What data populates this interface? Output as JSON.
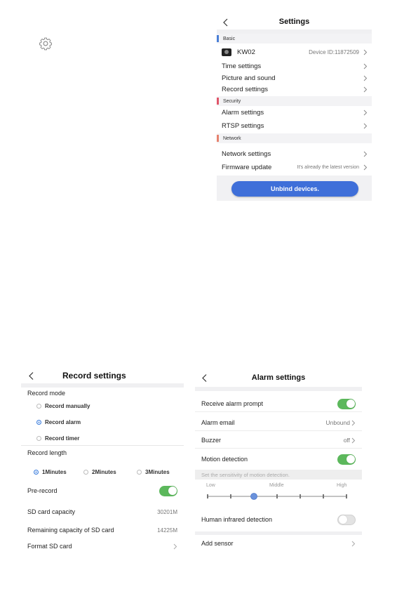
{
  "gear_icon": "gear-icon",
  "settings": {
    "title": "Settings",
    "sections": {
      "basic": "Basic",
      "security": "Security",
      "network": "Network"
    },
    "device": {
      "name": "KW02",
      "id": "Device ID:11872509"
    },
    "items": {
      "time": "Time settings",
      "picture": "Picture and sound",
      "record": "Record settings",
      "alarm": "Alarm settings",
      "rtsp": "RTSP settings",
      "network": "Network settings",
      "firmware": "Firmware update",
      "firmware_status": "It's already the latest version"
    },
    "unbind_label": "Unbind devices.",
    "colors": {
      "basic": "#4a7fd6",
      "security": "#e0566a",
      "network": "#e6826e",
      "button": "#3f6fd9"
    }
  },
  "record": {
    "title": "Record settings",
    "mode_label": "Record mode",
    "modes": [
      "Record manually",
      "Record alarm",
      "Record timer"
    ],
    "selected_mode": "Record alarm",
    "length_label": "Record length",
    "lengths": [
      "1Minutes",
      "2Minutes",
      "3Minutes"
    ],
    "selected_length": "1Minutes",
    "pre_record_label": "Pre-record",
    "pre_record_on": true,
    "sd_capacity_label": "SD card capacity",
    "sd_capacity_value": "30201M",
    "remaining_label": "Remaining capacity of SD card",
    "remaining_value": "14225M",
    "format_label": "Format SD card"
  },
  "alarm": {
    "title": "Alarm settings",
    "receive_label": "Receive alarm prompt",
    "receive_on": true,
    "email_label": "Alarm email",
    "email_value": "Unbound",
    "buzzer_label": "Buzzer",
    "buzzer_value": "off",
    "motion_label": "Motion detection",
    "motion_on": true,
    "sensitivity_hint": "Set the sensitivity of motion detection.",
    "sensitivity_levels": [
      "Low",
      "Middle",
      "High"
    ],
    "sensitivity_step": 3,
    "sensitivity_steps_total": 7,
    "human_label": "Human infrared detection",
    "human_on": false,
    "sensor_label": "Add sensor"
  }
}
